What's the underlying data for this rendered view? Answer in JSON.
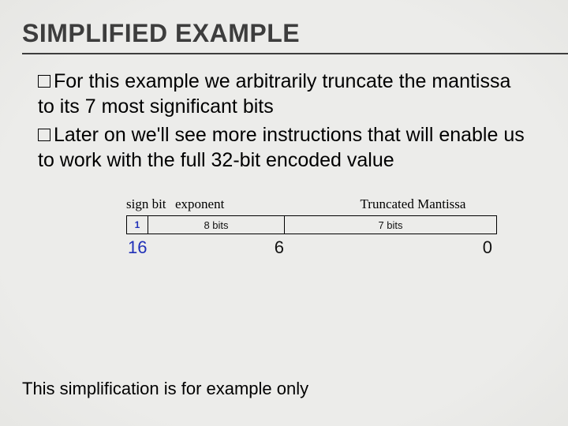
{
  "heading": "SIMPLIFIED EXAMPLE",
  "bullets": {
    "b1": "For this example we arbitrarily truncate the mantissa to its 7 most significant bits",
    "b2": "Later on we'll see more instructions that will enable us to work with the full 32-bit encoded value"
  },
  "diagram": {
    "labels": {
      "sign": "sign bit",
      "exponent": "exponent",
      "mantissa": "Truncated Mantissa"
    },
    "cells": {
      "sign": "1",
      "exponent": "8 bits",
      "mantissa": "7 bits"
    },
    "ticks": {
      "left": "16",
      "mid": "6",
      "right": "0"
    }
  },
  "footer": "This simplification is for example only"
}
